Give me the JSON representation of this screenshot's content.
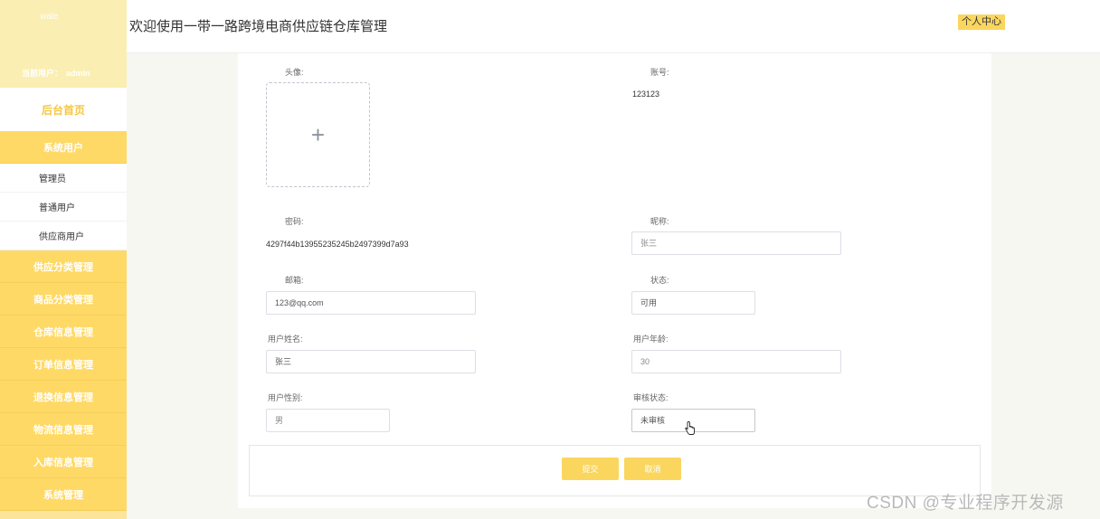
{
  "sidebar": {
    "logo": "wale",
    "user_label": "当前用户：",
    "user_name": "admin",
    "home": "后台首页",
    "groups": [
      {
        "label": "系统用户",
        "items": [
          "管理员",
          "普通用户",
          "供应商用户"
        ]
      },
      {
        "label": "供应分类管理"
      },
      {
        "label": "商品分类管理"
      },
      {
        "label": "仓库信息管理"
      },
      {
        "label": "订单信息管理"
      },
      {
        "label": "退换信息管理"
      },
      {
        "label": "物流信息管理"
      },
      {
        "label": "入库信息管理"
      },
      {
        "label": "系统管理"
      }
    ]
  },
  "header": {
    "title": "欢迎使用一带一路跨境电商供应链仓库管理",
    "user_center": "个人中心"
  },
  "form": {
    "avatar_label": "头像:",
    "account_label": "账号:",
    "account_value": "123123",
    "password_label": "密码:",
    "password_value": "4297f44b13955235245b2497399d7a93",
    "nickname_label": "昵称:",
    "nickname_value": "张三",
    "email_label": "邮箱:",
    "email_value": "123@qq.com",
    "status_label": "状态:",
    "status_value": "可用",
    "realname_label": "用户姓名:",
    "realname_value": "张三",
    "age_label": "用户年龄:",
    "age_value": "30",
    "gender_label": "用户性别:",
    "gender_value": "男",
    "audit_label": "审核状态:",
    "audit_value": "未审核",
    "submit": "提交",
    "cancel": "取消"
  },
  "watermark": "CSDN @专业程序开发源",
  "colors": {
    "accent": "#fad65f",
    "sidebar": "#fce59b",
    "menu": "#ffd966"
  },
  "icons": {
    "upload": "plus-icon",
    "cursor": "hand-pointer-icon"
  }
}
